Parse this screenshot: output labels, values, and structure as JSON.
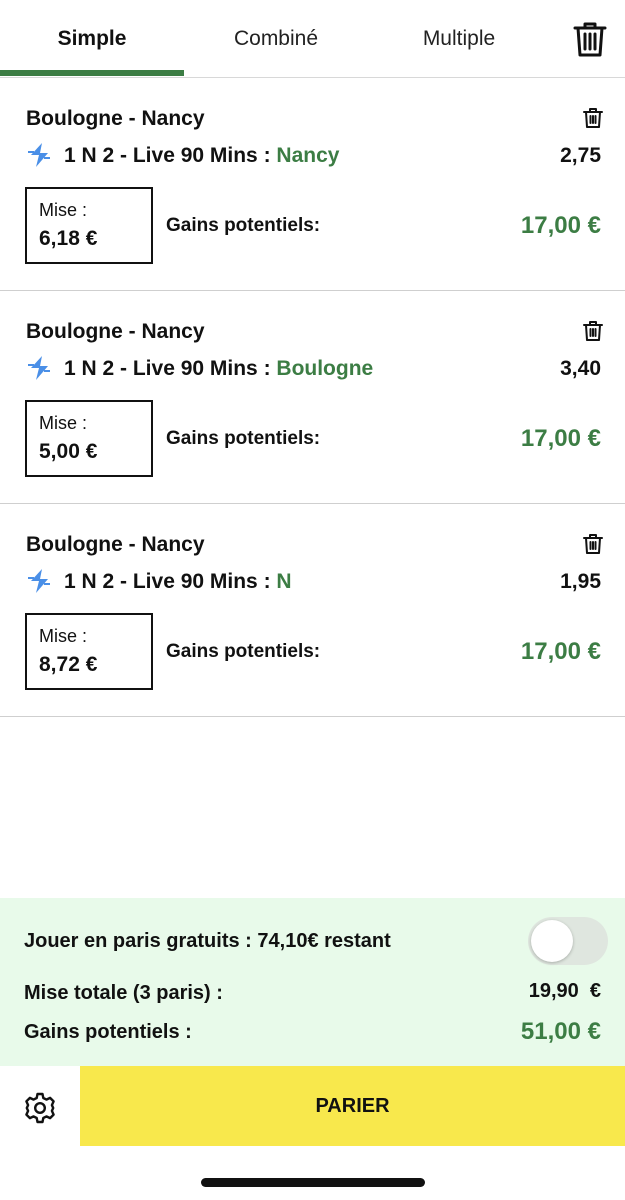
{
  "tabs": [
    {
      "label": "Simple",
      "active": true
    },
    {
      "label": "Combiné",
      "active": false
    },
    {
      "label": "Multiple",
      "active": false
    }
  ],
  "icons": {
    "trash": "trash-icon",
    "live": "lightning-icon",
    "settings": "gear-icon"
  },
  "colors": {
    "accent_green": "#3c7d44",
    "summary_bg": "#e8faea",
    "bet_button": "#f8e84c",
    "live_icon_blue": "#4a8fe7"
  },
  "bets": [
    {
      "match": "Boulogne - Nancy",
      "market": "1 N 2 - Live 90 Mins : ",
      "selection": "Nancy",
      "odds": "2,75",
      "stake_label": "Mise :",
      "stake_value": "6,18 €",
      "gains_label": "Gains potentiels:",
      "gains_value": "17,00 €"
    },
    {
      "match": "Boulogne - Nancy",
      "market": "1 N 2 - Live 90 Mins : ",
      "selection": "Boulogne",
      "odds": "3,40",
      "stake_label": "Mise :",
      "stake_value": "5,00 €",
      "gains_label": "Gains potentiels:",
      "gains_value": "17,00 €"
    },
    {
      "match": "Boulogne - Nancy",
      "market": "1 N 2 - Live 90 Mins : ",
      "selection": "N",
      "odds": "1,95",
      "stake_label": "Mise :",
      "stake_value": "8,72 €",
      "gains_label": "Gains potentiels:",
      "gains_value": "17,00 €"
    }
  ],
  "summary": {
    "free_bets_label": "Jouer en paris gratuits : 74,10€ restant",
    "free_bets_toggle_on": false,
    "total_stake_label": "Mise totale (3 paris) :",
    "total_stake_value": "19,90  €",
    "potential_gains_label": "Gains potentiels :",
    "potential_gains_value": "51,00 €"
  },
  "footer": {
    "bet_button_label": "PARIER"
  }
}
